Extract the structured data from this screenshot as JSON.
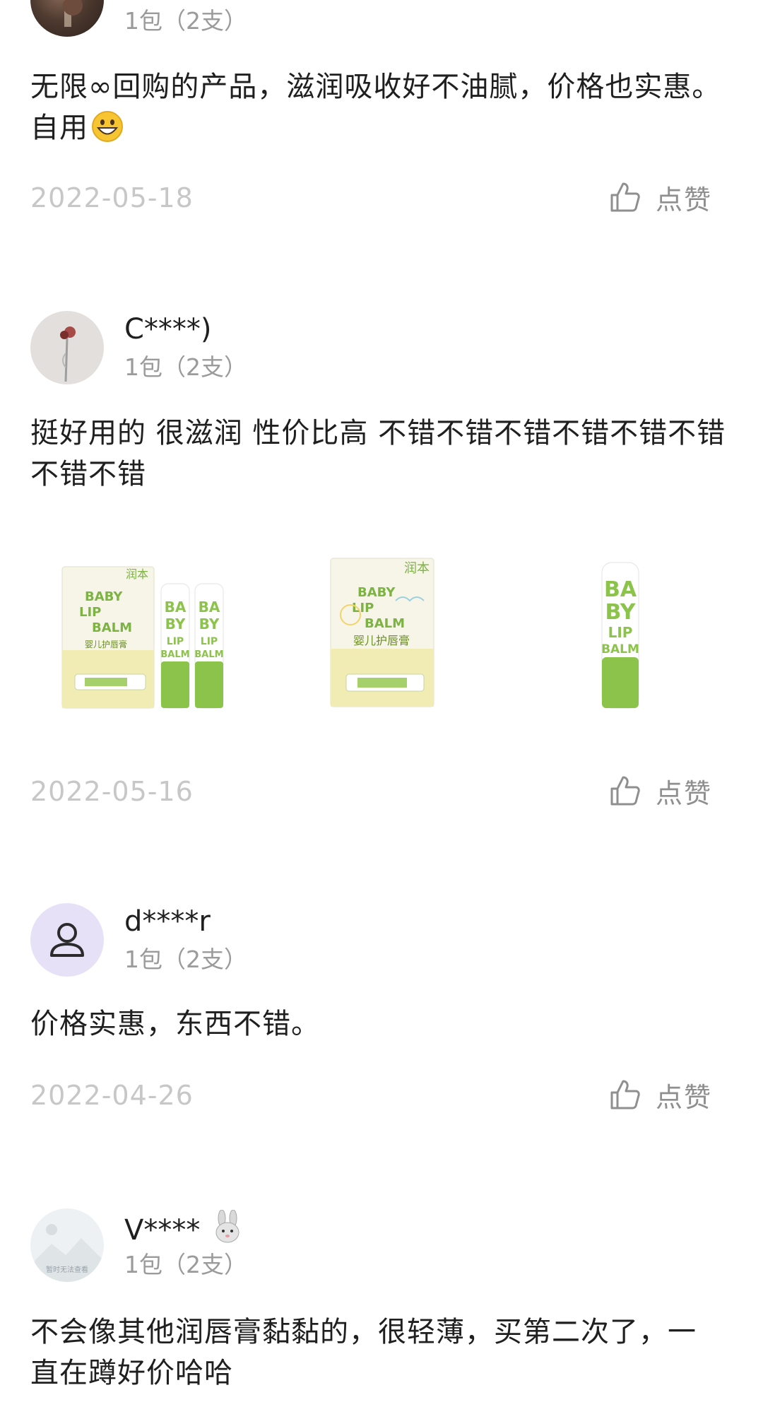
{
  "reviews": [
    {
      "variant": "1包（2支）",
      "text": "无限∞回购的产品，滋润吸收好不油腻，价格也实惠。自用",
      "date": "2022-05-18",
      "like_label": "点赞"
    },
    {
      "username": "C****)",
      "variant": "1包（2支）",
      "text_line1": "挺好用的 很滋润 性价比高 不错不错不错不错不错不错",
      "text_line2": "不错不错",
      "date": "2022-05-16",
      "like_label": "点赞",
      "images": [
        {
          "brand": "润本",
          "line1": "BABY",
          "line2": "LIP",
          "line3": "BALM",
          "product": "婴儿护唇膏"
        },
        {
          "brand": "润本",
          "line1": "BABY",
          "line2": "LIP",
          "line3": "BALM",
          "product": "婴儿护唇膏"
        },
        {
          "line1": "BA",
          "line2": "BY",
          "line3": "LIP",
          "line4": "BALM"
        }
      ]
    },
    {
      "username": "d****r",
      "variant": "1包（2支）",
      "text": "价格实惠，东西不错。",
      "date": "2022-04-26",
      "like_label": "点赞"
    },
    {
      "username": "V****",
      "avatar_caption": "暂时无法查看",
      "variant": "1包（2支）",
      "text_line1": "不会像其他润唇膏黏黏的，很轻薄，买第二次了，一",
      "text_line2": "直在蹲好价哈哈"
    }
  ],
  "colors": {
    "text": "#1f1f1f",
    "muted": "#9b9b9b",
    "date": "#c7c7c7",
    "accent_green": "#7cb342",
    "avatar_purple_bg": "#e6e1f7",
    "avatar_purple_fg": "#5c4fc4"
  },
  "icons": {
    "like": "thumbs-up-icon",
    "emoji": "grinning-face-emoji",
    "rabbit": "rabbit-emoji"
  }
}
